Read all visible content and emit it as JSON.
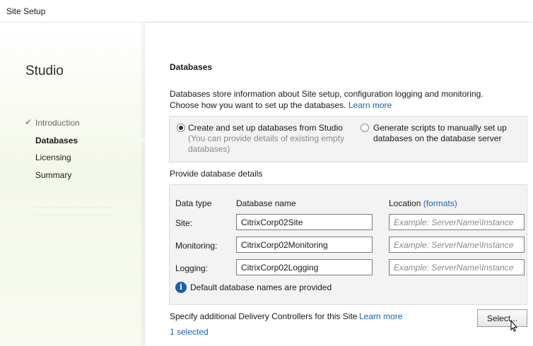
{
  "window": {
    "title": "Site Setup"
  },
  "sidebar": {
    "brand": "Studio",
    "steps": [
      {
        "label": "Introduction",
        "state": "done"
      },
      {
        "label": "Databases",
        "state": "current"
      },
      {
        "label": "Licensing",
        "state": "pending"
      },
      {
        "label": "Summary",
        "state": "pending"
      }
    ]
  },
  "main": {
    "heading": "Databases",
    "intro_line1": "Databases store information about Site setup, configuration logging and monitoring.",
    "intro_line2": "Choose how you want to set up the databases.",
    "learn_more": "Learn more",
    "options": {
      "create": {
        "label": "Create and set up databases from Studio",
        "sub": "(You can provide details of existing empty databases)",
        "selected": true
      },
      "generate": {
        "label": "Generate scripts to manually set up databases on the database server",
        "selected": false
      }
    },
    "provide_label": "Provide database details",
    "table": {
      "col_type": "Data type",
      "col_name": "Database name",
      "col_location": "Location",
      "formats_link": "(formats)",
      "rows": [
        {
          "type": "Site:",
          "name": "CitrixCorp02Site",
          "location_placeholder": "Example: ServerName\\Instance"
        },
        {
          "type": "Monitoring:",
          "name": "CitrixCorp02Monitoring",
          "location_placeholder": "Example: ServerName\\Instance"
        },
        {
          "type": "Logging:",
          "name": "CitrixCorp02Logging",
          "location_placeholder": "Example: ServerName\\Instance"
        }
      ]
    },
    "info_text": "Default database names are provided",
    "controllers_label": "Specify additional Delivery Controllers for this Site",
    "controllers_learn_more": "Learn more",
    "selected_count": "1 selected",
    "select_button": "Select..."
  },
  "colors": {
    "link": "#1a5fb4",
    "sidebar_tint": "#f4f8ea",
    "panel": "#f3f3f3"
  },
  "icons": {
    "info": "info-icon",
    "check": "check-icon",
    "cursor": "mouse-pointer-icon"
  }
}
